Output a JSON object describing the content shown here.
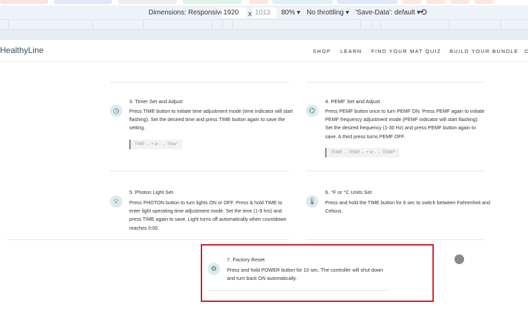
{
  "devtools": {
    "dimensions_label": "Dimensions: Responsive",
    "width": "1920",
    "x": "x",
    "height": "1013",
    "zoom": "80%",
    "throttling": "No throttling",
    "save_data": "'Save-Data': default"
  },
  "nav": {
    "logo": "HealthyLine",
    "links": [
      "SHOP",
      "LEARN",
      "FIND YOUR MAT QUIZ",
      "BUILD YOUR BUNDLE",
      "C"
    ]
  },
  "cards": [
    {
      "title": "3. Timer Set and Adjust",
      "icon": "clock-icon",
      "text": "Press TIME button to initiate time adjustment mode (time indicator will start flashing). Set the desired time and press TIME button again to save the setting.",
      "code": "TIME → + or - → Time*"
    },
    {
      "title": "4. PEMF Set and Adjust",
      "icon": "pemf-icon",
      "text": "Press PEMF button once to turn PEMF ON. Press PEMF again to initiate PEMF frequency adjustment mode (PEMF indicator will start flashing). Set the desired frequency (1-30 Hz) and press PEMF button again to save. A third press turns PEMF OFF.",
      "code": "TEMP → TEMP → + or - → TEMP*"
    },
    {
      "title": "5. Photon Light Set",
      "icon": "light-bulb-icon",
      "text": "Press PHOTON button to turn lights ON or OFF. Press & hold TIME to enter light operating time adjustment mode. Set the time (1-9 hrs) and press TIME again to save. Light turns off automatically when countdown reaches 0:00."
    },
    {
      "title": "6. °F or °C Units Set",
      "icon": "thermometer-icon",
      "text": "Press and hold the TIME button for 6 sec to switch between Fahrenheit and Celsius."
    },
    {
      "title": "7. Factory Reset",
      "icon": "gear-icon",
      "text": "Press and hold POWER button for 10 sec. The controller will shut down and turn back ON automatically."
    }
  ],
  "colors": {
    "highlight": "#d9161b",
    "icon_bg": "#dcebef"
  }
}
